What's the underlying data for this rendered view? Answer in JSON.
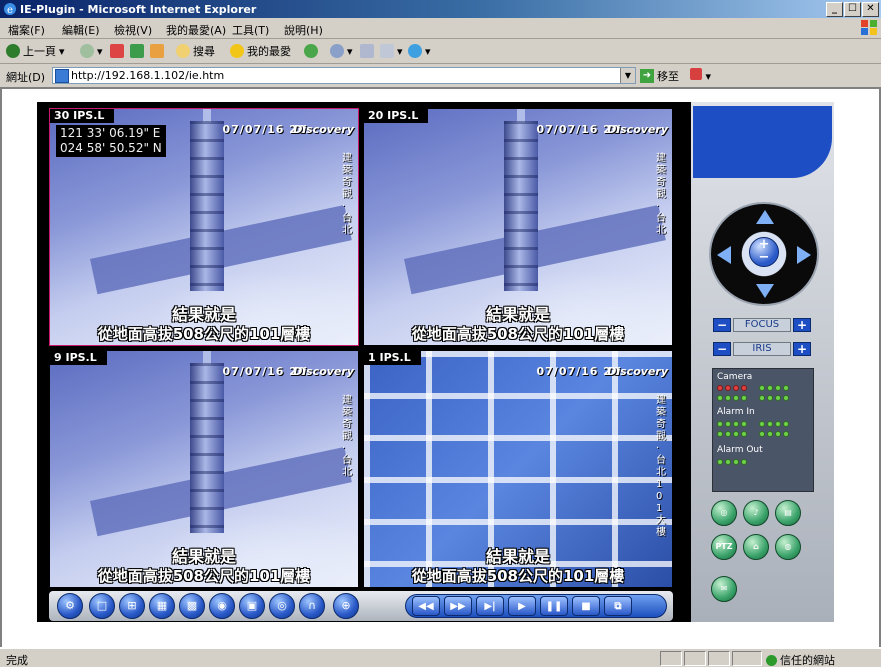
{
  "window": {
    "title": "IE-Plugin - Microsoft Internet Explorer",
    "controls": [
      "_",
      "☐",
      "✕"
    ]
  },
  "menu": [
    "檔案(F)",
    "編輯(E)",
    "檢視(V)",
    "我的最愛(A)",
    "工具(T)",
    "說明(H)"
  ],
  "toolbar": {
    "back": "上一頁",
    "search": "搜尋",
    "favorites": "我的最愛"
  },
  "address": {
    "label": "網址(D)",
    "url": "http://192.168.1.102/ie.htm",
    "go": "移至"
  },
  "videos": [
    {
      "ips": "30 IPS.L",
      "timestamp": "07/07/16 20:",
      "logo": "Discovery",
      "vertical": "建築奇觀·台北",
      "coords": [
        "121 33' 06.19\" E",
        "024 58' 50.52\" N"
      ],
      "sub1": "結果就是",
      "sub2": "從地面高拔508公尺的101層樓"
    },
    {
      "ips": "20 IPS.L",
      "timestamp": "07/07/16 20:",
      "logo": "Discovery",
      "vertical": "建築奇觀·台北",
      "sub1": "結果就是",
      "sub2": "從地面高拔508公尺的101層樓"
    },
    {
      "ips": "9 IPS.L",
      "timestamp": "07/07/16 20:",
      "logo": "Discovery",
      "vertical": "建築奇觀·台北",
      "sub1": "結果就是",
      "sub2": "從地面高拔508公尺的101層樓"
    },
    {
      "ips": "1 IPS.L",
      "timestamp": "07/07/16 20:",
      "logo": "Discovery",
      "vertical": "建築奇觀·台北101大樓",
      "sub1": "結果就是",
      "sub2": "從地面高拔508公尺的101層樓"
    }
  ],
  "ptz": {
    "focus_label": "FOCUS",
    "iris_label": "IRIS",
    "minus": "−",
    "plus": "+"
  },
  "status_panel": {
    "camera_label": "Camera",
    "alarm_in_label": "Alarm In",
    "alarm_out_label": "Alarm Out"
  },
  "right_buttons": [
    "PTZ"
  ],
  "statusbar": {
    "done": "完成",
    "zone": "信任的網站"
  }
}
